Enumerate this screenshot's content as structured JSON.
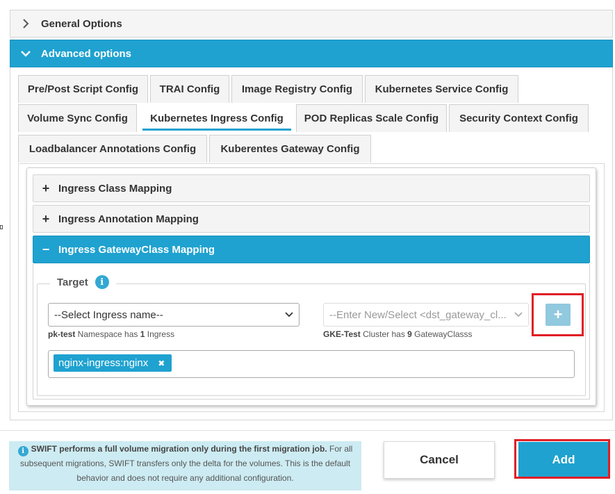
{
  "general_options": {
    "label": "General Options"
  },
  "advanced_options": {
    "label": "Advanced options"
  },
  "tabs": [
    {
      "label": "Pre/Post Script Config"
    },
    {
      "label": "TRAI Config"
    },
    {
      "label": "Image Registry Config"
    },
    {
      "label": "Kubernetes Service Config"
    },
    {
      "label": "Volume Sync Config"
    },
    {
      "label": "Kubernetes Ingress Config",
      "active": true
    },
    {
      "label": "POD Replicas Scale Config"
    },
    {
      "label": "Security Context Config"
    },
    {
      "label": "Loadbalancer Annotations Config"
    },
    {
      "label": "Kuberentes Gateway Config"
    }
  ],
  "accordions": [
    {
      "label": "Ingress Class Mapping",
      "sign": "+"
    },
    {
      "label": "Ingress Annotation Mapping",
      "sign": "+"
    },
    {
      "label": "Ingress GatewayClass Mapping",
      "sign": "−"
    }
  ],
  "target": {
    "legend": "Target",
    "info_icon": "i",
    "ingress_select": {
      "value": "--Select Ingress name--",
      "hint": {
        "name": "pk-test",
        "mid": " Namespace has ",
        "count": "1",
        "tail": " Ingress"
      }
    },
    "gateway_select": {
      "placeholder": "--Enter New/Select <dst_gateway_cl...",
      "hint": {
        "name": "GKE-Test",
        "mid": " Cluster has ",
        "count": "9",
        "tail": " GatewayClasss"
      }
    },
    "add_mapping_button": "+",
    "tags": [
      {
        "label": "nginx-ingress:nginx",
        "remove": "✖"
      }
    ]
  },
  "footer": {
    "note": {
      "icon": "i",
      "bold": "SWIFT performs a full volume migration only during the first migration job.",
      "rest": " For all subsequent migrations, SWIFT transfers only the delta for the volumes. This is the default behavior and does not require any additional configuration."
    },
    "cancel_label": "Cancel",
    "add_label": "Add"
  },
  "colors": {
    "accent": "#1fa2d0",
    "highlight": "#e01e26",
    "note_bg": "#cdebf2"
  }
}
